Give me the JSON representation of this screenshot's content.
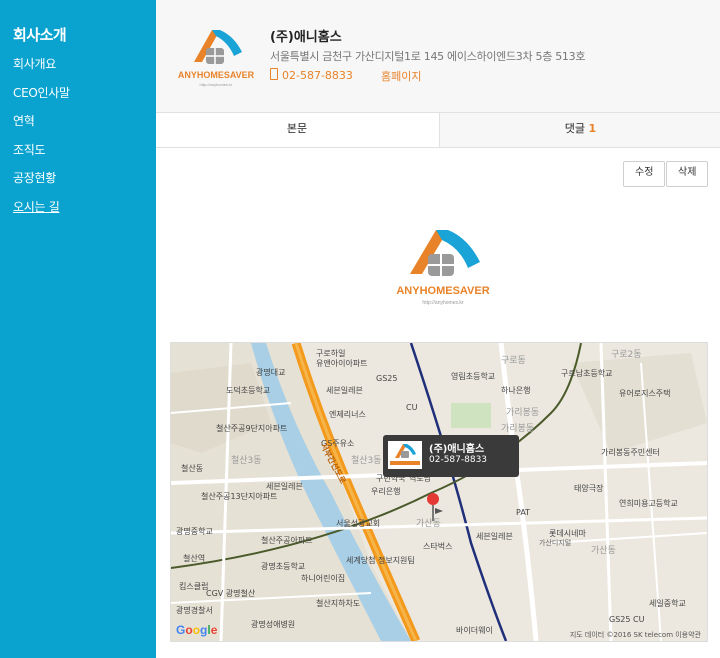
{
  "sidebar": {
    "title": "회사소개",
    "items": [
      {
        "label": "회사개요"
      },
      {
        "label": "CEO인사말"
      },
      {
        "label": "연혁"
      },
      {
        "label": "조직도"
      },
      {
        "label": "공장현황"
      },
      {
        "label": "오시는 길"
      }
    ]
  },
  "header": {
    "logo_text": "ANYHOMESAVER",
    "logo_url": "http://anyhomes.kr",
    "company_name": "(주)애니홈스",
    "address": "서울특별시 금천구 가산디지털1로 145 에이스하이엔드3차 5층 513호",
    "phone": "02-587-8833",
    "homepage_label": "홈페이지"
  },
  "tabs": {
    "body_label": "본문",
    "comment_label": "댓글",
    "comment_count": "1"
  },
  "buttons": {
    "edit_label": "수정",
    "delete_label": "삭제"
  },
  "content": {
    "logo_text": "ANYHOMESAVER",
    "logo_url": "http://anyhomes.kr"
  },
  "map": {
    "infowindow": {
      "name": "(주)애니홈스",
      "phone": "02-587-8833"
    },
    "labels": {
      "l1": "구로하일",
      "l2": "유앤아이아파트",
      "l3": "광명대교",
      "l4": "GS25",
      "l5": "영림초등학교",
      "l6": "구로2동",
      "l7": "구로남초등학교",
      "l8": "도덕초등학교",
      "l9": "세븐일레븐",
      "l10": "하나은행",
      "l11": "유어로지스주택",
      "l12": "철산주공9단지아파트",
      "l13": "엔제리너스",
      "l14": "GS주유소",
      "l15": "가리봉동",
      "l16": "철산3동",
      "l17": "철산동",
      "l18": "구민약국",
      "l19": "역도남",
      "l20": "가리봉동주민센터",
      "l21": "철산주공13단지아파트",
      "l22": "우리은행",
      "l23": "태양극장",
      "l24": "서울성광교회",
      "l25": "가산동",
      "l26": "연희미용고등학교",
      "l27": "광명중학교",
      "l28": "철산주공아파트",
      "l29": "세븐일레븐",
      "l30": "롯데시네마",
      "l31": "가산디지털",
      "l32": "철산역",
      "l33": "세계당첨 정보지원팀",
      "l34": "광명초등학교",
      "l35": "킴스클럽",
      "l36": "CGV 광명철산",
      "l37": "하니어린이집",
      "l38": "광명경찰서",
      "l39": "철산지하차도",
      "l40": "세일중학교",
      "l41": "바이더웨이",
      "l42": "광명성애병원",
      "l43": "스타벅스",
      "l44": "PAT",
      "l45": "구로동",
      "l46": "가리봉동",
      "l47": "GS25 CU",
      "l48": "서부간선도로",
      "l49": "CU",
      "l50": "철산3동",
      "l51": "가산동",
      "l52": "세븐일레븐"
    },
    "copyright": "지도 데이터 ©2016 SK telecom    이용약관"
  },
  "colors": {
    "sidebar_bg": "#0aa3cf",
    "accent_orange": "#e8832a",
    "map_road_orange": "#f39a1d",
    "map_river": "#a8cfe6",
    "map_rail_navy": "#1f2f7a"
  }
}
